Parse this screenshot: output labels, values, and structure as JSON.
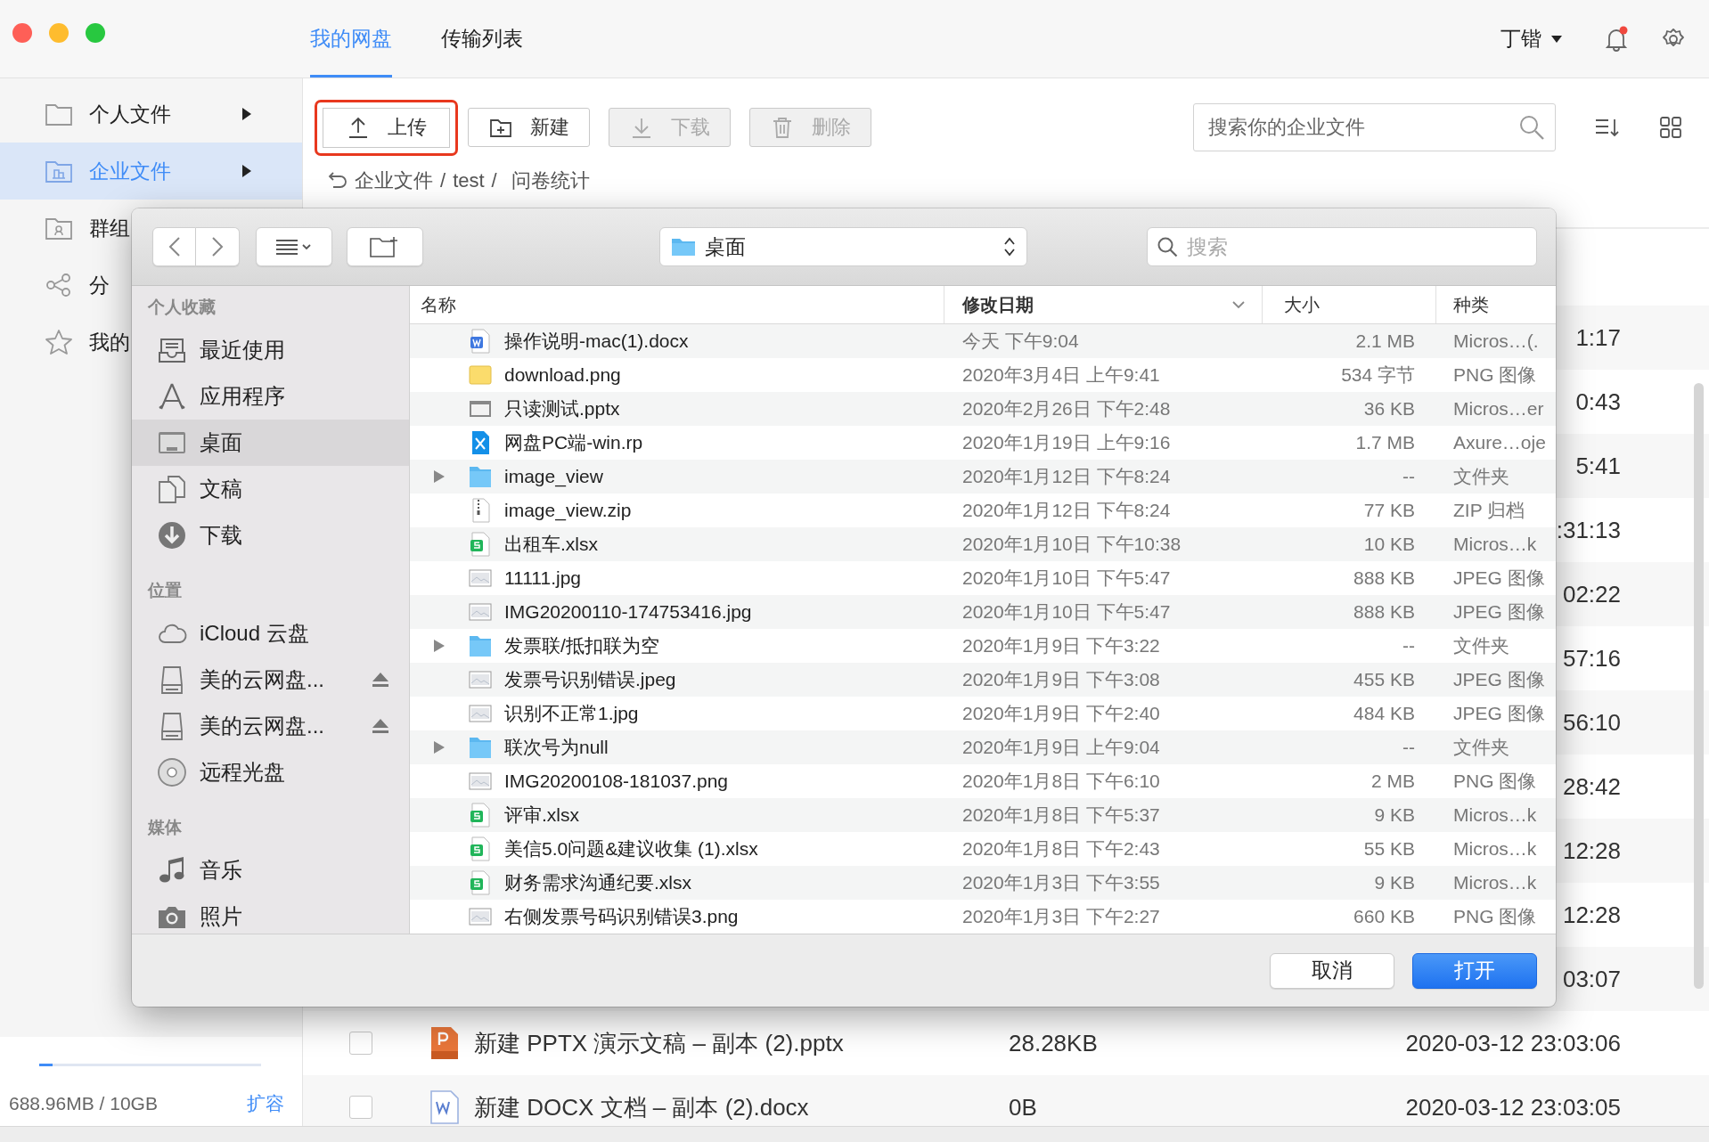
{
  "top_nav": {
    "tabs": [
      {
        "label": "我的网盘",
        "selected": true
      },
      {
        "label": "传输列表",
        "selected": false
      }
    ],
    "user": "丁锴",
    "unread_notifications": true
  },
  "sidebar": {
    "items": [
      {
        "label": "个人文件",
        "kind": "folder",
        "selected": false,
        "has_submenu": true
      },
      {
        "label": "企业文件",
        "kind": "company",
        "selected": true,
        "has_submenu": true
      },
      {
        "label": "群组",
        "kind": "group",
        "selected": false
      },
      {
        "label": "分",
        "kind": "share",
        "selected": false
      },
      {
        "label": "我的",
        "kind": "star",
        "selected": false
      }
    ],
    "storage": {
      "level": 0.06,
      "text": "688.96MB / 10GB",
      "action": "扩容"
    }
  },
  "toolbar": {
    "buttons": [
      {
        "label": "上传",
        "kind": "upload",
        "disabled": false,
        "highlighted": true
      },
      {
        "label": "新建",
        "kind": "new",
        "disabled": false,
        "highlighted": false
      },
      {
        "label": "下载",
        "kind": "download",
        "disabled": true,
        "highlighted": false
      },
      {
        "label": "删除",
        "kind": "delete",
        "disabled": true,
        "highlighted": false
      }
    ],
    "search_placeholder": "搜索你的企业文件"
  },
  "breadcrumb": {
    "items": [
      "企业文件",
      "test",
      "问卷统计"
    ],
    "separator": "/"
  },
  "file_table": {
    "rows": [
      {
        "modified": "1:17"
      },
      {
        "modified": "0:43"
      },
      {
        "modified": "5:41"
      },
      {
        "modified": ":31:13"
      },
      {
        "modified": "02:22"
      },
      {
        "modified": "57:16"
      },
      {
        "modified": "56:10"
      },
      {
        "modified": "28:42"
      },
      {
        "modified": "12:28"
      },
      {
        "modified": "12:28"
      },
      {
        "modified": "03:07"
      },
      {
        "name": "新建 PPTX 演示文稿 – 副本 (2).pptx",
        "kind": "pptx",
        "size": "28.28KB",
        "modified": "2020-03-12 23:03:06",
        "checked": false
      },
      {
        "name": "新建 DOCX 文档 – 副本 (2).docx",
        "kind": "docx",
        "size": "0B",
        "modified": "2020-03-12 23:03:05",
        "checked": false
      }
    ]
  },
  "open_dialog": {
    "location": "桌面",
    "search_placeholder": "搜索",
    "sidebar": [
      {
        "title": "个人收藏",
        "items": [
          {
            "label": "最近使用",
            "kind": "recent",
            "selected": false,
            "ejectable": false
          },
          {
            "label": "应用程序",
            "kind": "apps",
            "selected": false,
            "ejectable": false
          },
          {
            "label": "桌面",
            "kind": "desktop",
            "selected": true,
            "ejectable": false
          },
          {
            "label": "文稿",
            "kind": "documents",
            "selected": false,
            "ejectable": false
          },
          {
            "label": "下载",
            "kind": "downloads",
            "selected": false,
            "ejectable": false
          }
        ]
      },
      {
        "title": "位置",
        "items": [
          {
            "label": "iCloud 云盘",
            "kind": "cloud",
            "selected": false,
            "ejectable": false
          },
          {
            "label": "美的云网盘...",
            "kind": "drive",
            "selected": false,
            "ejectable": true
          },
          {
            "label": "美的云网盘...",
            "kind": "drive",
            "selected": false,
            "ejectable": true
          },
          {
            "label": "远程光盘",
            "kind": "disc",
            "selected": false,
            "ejectable": false
          }
        ]
      },
      {
        "title": "媒体",
        "items": [
          {
            "label": "音乐",
            "kind": "music",
            "selected": false,
            "ejectable": false
          },
          {
            "label": "照片",
            "kind": "photos",
            "selected": false,
            "ejectable": false
          }
        ]
      }
    ],
    "columns": [
      {
        "label": "名称",
        "sorted": false
      },
      {
        "label": "修改日期",
        "sorted": true
      },
      {
        "label": "大小",
        "sorted": false
      },
      {
        "label": "种类",
        "sorted": false
      }
    ],
    "files": [
      {
        "name": "操作说明-mac(1).docx",
        "kind": "word",
        "modified": "今天 下午9:04",
        "size": "2.1 MB",
        "type": "Micros…(."
      },
      {
        "name": "download.png",
        "kind": "yellow-image",
        "modified": "2020年3月4日 上午9:41",
        "size": "534 字节",
        "type": "PNG 图像"
      },
      {
        "name": "只读测试.pptx",
        "kind": "slide",
        "modified": "2020年2月26日 下午2:48",
        "size": "36 KB",
        "type": "Micros…er"
      },
      {
        "name": "网盘PC端-win.rp",
        "kind": "axure",
        "modified": "2020年1月19日 上午9:16",
        "size": "1.7 MB",
        "type": "Axure…oje"
      },
      {
        "name": "image_view",
        "kind": "folder",
        "modified": "2020年1月12日 下午8:24",
        "size": "--",
        "type": "文件夹"
      },
      {
        "name": "image_view.zip",
        "kind": "zip",
        "modified": "2020年1月12日 下午8:24",
        "size": "77 KB",
        "type": "ZIP 归档"
      },
      {
        "name": "出租车.xlsx",
        "kind": "sheet",
        "modified": "2020年1月10日 下午10:38",
        "size": "10 KB",
        "type": "Micros…k"
      },
      {
        "name": "11111.jpg",
        "kind": "image",
        "modified": "2020年1月10日 下午5:47",
        "size": "888 KB",
        "type": "JPEG 图像"
      },
      {
        "name": "IMG20200110-174753416.jpg",
        "kind": "image",
        "modified": "2020年1月10日 下午5:47",
        "size": "888 KB",
        "type": "JPEG 图像"
      },
      {
        "name": "发票联/抵扣联为空",
        "kind": "folder",
        "modified": "2020年1月9日 下午3:22",
        "size": "--",
        "type": "文件夹"
      },
      {
        "name": "发票号识别错误.jpeg",
        "kind": "image",
        "modified": "2020年1月9日 下午3:08",
        "size": "455 KB",
        "type": "JPEG 图像"
      },
      {
        "name": "识别不正常1.jpg",
        "kind": "image",
        "modified": "2020年1月9日 下午2:40",
        "size": "484 KB",
        "type": "JPEG 图像"
      },
      {
        "name": "联次号为null",
        "kind": "folder",
        "modified": "2020年1月9日 上午9:04",
        "size": "--",
        "type": "文件夹"
      },
      {
        "name": "IMG20200108-181037.png",
        "kind": "image",
        "modified": "2020年1月8日 下午6:10",
        "size": "2 MB",
        "type": "PNG 图像"
      },
      {
        "name": "评审.xlsx",
        "kind": "sheet",
        "modified": "2020年1月8日 下午5:37",
        "size": "9 KB",
        "type": "Micros…k"
      },
      {
        "name": "美信5.0问题&建议收集 (1).xlsx",
        "kind": "sheet",
        "modified": "2020年1月8日 下午2:43",
        "size": "55 KB",
        "type": "Micros…k"
      },
      {
        "name": "财务需求沟通纪要.xlsx",
        "kind": "sheet",
        "modified": "2020年1月3日 下午3:55",
        "size": "9 KB",
        "type": "Micros…k"
      },
      {
        "name": "右侧发票号码识别错误3.png",
        "kind": "image",
        "modified": "2020年1月3日 下午2:27",
        "size": "660 KB",
        "type": "PNG 图像"
      }
    ],
    "buttons": [
      {
        "label": "取消",
        "kind": "cancel"
      },
      {
        "label": "打开",
        "kind": "default"
      }
    ]
  }
}
